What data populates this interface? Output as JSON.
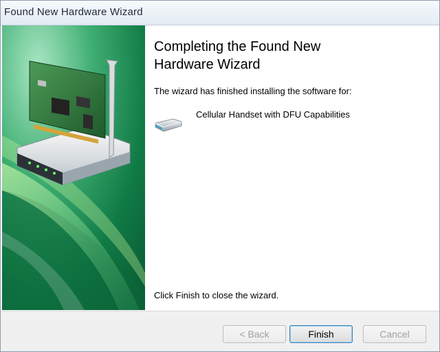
{
  "window": {
    "title": "Found New Hardware Wizard"
  },
  "main": {
    "heading": "Completing the Found New Hardware Wizard",
    "intro": "The wizard has finished installing the software for:",
    "device": {
      "name": "Cellular Handset with DFU Capabilities",
      "icon": "usb-device-icon"
    },
    "outro": "Click Finish to close the wizard."
  },
  "buttons": {
    "back": "< Back",
    "finish": "Finish",
    "cancel": "Cancel"
  },
  "colors": {
    "panel_green": "#1f8a4a",
    "panel_light": "#7fd0a0",
    "default_button_border": "#3c7fb1"
  }
}
